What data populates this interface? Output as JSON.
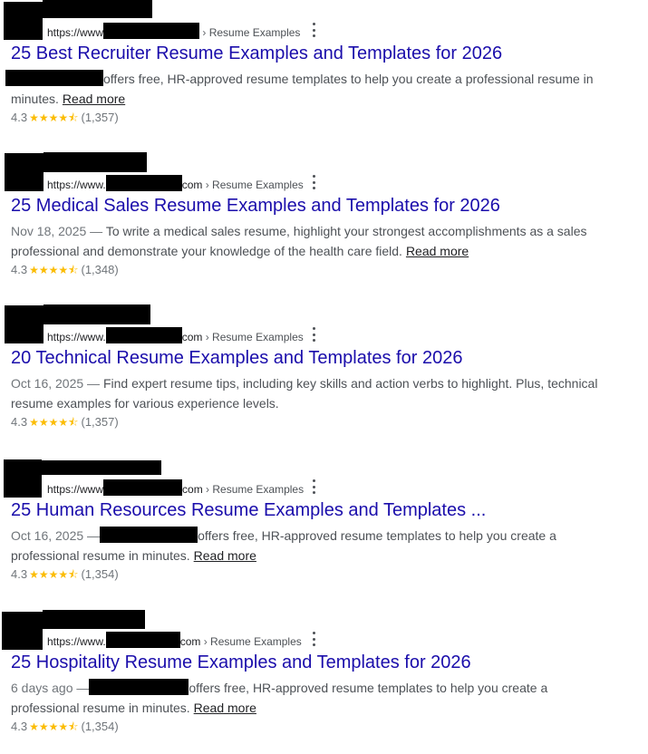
{
  "results": [
    {
      "breadcrumb_url": "https://www",
      "breadcrumb_sep": "›",
      "breadcrumb_path": "Resume Examples",
      "title": "25 Best Recruiter Resume Examples and Templates for 2026",
      "date": "",
      "snippet": "offers free, HR-approved resume templates to help you create a professional resume in minutes.",
      "read_more": "Read more",
      "rating": "4.3",
      "stars": "★★★★⯪",
      "reviews": "(1,357)"
    },
    {
      "breadcrumb_url": "https://www.",
      "breadcrumb_domain_tail": "com",
      "breadcrumb_sep": "›",
      "breadcrumb_path": "Resume Examples",
      "title": "25 Medical Sales Resume Examples and Templates for 2026",
      "date": "Nov 18, 2025 —",
      "snippet": "To write a medical sales resume, highlight your strongest accomplishments as a sales professional and demonstrate your knowledge of the health care field.",
      "read_more": "Read more",
      "rating": "4.3",
      "stars": "★★★★⯪",
      "reviews": "(1,348)"
    },
    {
      "breadcrumb_url": "https://www.",
      "breadcrumb_domain_tail": "com",
      "breadcrumb_sep": "›",
      "breadcrumb_path": "Resume Examples",
      "title": "20 Technical Resume Examples and Templates for 2026",
      "date": "Oct 16, 2025 —",
      "snippet": "Find expert resume tips, including key skills and action verbs to highlight. Plus, technical resume examples for various experience levels.",
      "read_more": "",
      "rating": "4.3",
      "stars": "★★★★⯪",
      "reviews": "(1,357)"
    },
    {
      "breadcrumb_url": "https://www",
      "breadcrumb_domain_tail": "com",
      "breadcrumb_sep": "›",
      "breadcrumb_path": "Resume Examples",
      "title": "25 Human Resources Resume Examples and Templates ...",
      "date": "Oct 16, 2025 —",
      "snippet": "offers free, HR-approved resume templates to help you create a professional resume in minutes.",
      "read_more": "Read more",
      "rating": "4.3",
      "stars": "★★★★⯪",
      "reviews": "(1,354)"
    },
    {
      "breadcrumb_url": "https://www.",
      "breadcrumb_domain_tail": "com",
      "breadcrumb_sep": "›",
      "breadcrumb_path": "Resume Examples",
      "title": "25 Hospitality Resume Examples and Templates for 2026",
      "date": "6 days ago —",
      "snippet": "offers free, HR-approved resume templates to help you create a professional resume in minutes.",
      "read_more": "Read more",
      "rating": "4.3",
      "stars": "★★★★⯪",
      "reviews": "(1,354)"
    }
  ],
  "colors": {
    "title_link": "#1a0dab",
    "star": "#fbbc04",
    "snippet_text": "#4d5156",
    "meta_text": "#70757a"
  },
  "icons": {
    "more_options": "kebab-menu-icon",
    "rating_stars": "star-icon"
  }
}
